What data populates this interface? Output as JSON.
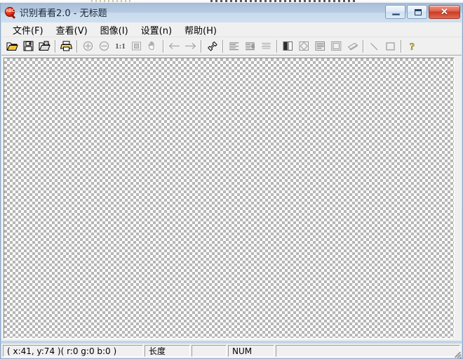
{
  "window": {
    "title": "识别看看2.0 - 无标题",
    "app_icon": "ocr-magnifier-icon",
    "icon_text": "ABC",
    "controls": {
      "minimize_label": "",
      "maximize_label": "",
      "close_label": "✕"
    },
    "accent_title_top": "#9fb7d4",
    "accent_title_bottom": "#cfdff0",
    "close_color": "#c93a24",
    "frame_color": "#c2d4e9"
  },
  "menubar": {
    "items": [
      {
        "label": "文件(F)",
        "name": "menu-file"
      },
      {
        "label": "查看(V)",
        "name": "menu-view"
      },
      {
        "label": "图像(I)",
        "name": "menu-image"
      },
      {
        "label": "设置(n)",
        "name": "menu-settings"
      },
      {
        "label": "帮助(H)",
        "name": "menu-help"
      }
    ]
  },
  "toolbar": {
    "zoom_ratio_label": "1:1",
    "help_label": "?",
    "buttons": [
      {
        "name": "open-file-icon",
        "tooltip": "打开",
        "type": "icon"
      },
      {
        "name": "save-file-icon",
        "tooltip": "保存",
        "type": "icon"
      },
      {
        "name": "save-as-icon",
        "tooltip": "另存为",
        "type": "icon"
      },
      {
        "name": "separator",
        "tooltip": "",
        "type": "sep"
      },
      {
        "name": "print-icon",
        "tooltip": "打印",
        "type": "icon"
      },
      {
        "name": "separator",
        "tooltip": "",
        "type": "sep"
      },
      {
        "name": "zoom-in-icon",
        "tooltip": "放大",
        "type": "icon"
      },
      {
        "name": "zoom-out-icon",
        "tooltip": "缩小",
        "type": "icon"
      },
      {
        "name": "actual-size-icon",
        "tooltip": "1:1",
        "type": "text"
      },
      {
        "name": "fit-to-window-icon",
        "tooltip": "适应窗口",
        "type": "icon"
      },
      {
        "name": "pan-hand-icon",
        "tooltip": "平移",
        "type": "icon"
      },
      {
        "name": "separator",
        "tooltip": "",
        "type": "sep"
      },
      {
        "name": "previous-arrow-icon",
        "tooltip": "上一个",
        "type": "icon"
      },
      {
        "name": "next-arrow-icon",
        "tooltip": "下一个",
        "type": "icon"
      },
      {
        "name": "separator",
        "tooltip": "",
        "type": "sep"
      },
      {
        "name": "measure-length-icon",
        "tooltip": "长度",
        "type": "icon"
      },
      {
        "name": "separator",
        "tooltip": "",
        "type": "sep"
      },
      {
        "name": "align-left-icon",
        "tooltip": "左对齐",
        "type": "icon"
      },
      {
        "name": "align-mixed-icon",
        "tooltip": "对齐",
        "type": "icon"
      },
      {
        "name": "align-justify-icon",
        "tooltip": "两端对齐",
        "type": "icon"
      },
      {
        "name": "separator",
        "tooltip": "",
        "type": "sep"
      },
      {
        "name": "contrast-icon",
        "tooltip": "对比度",
        "type": "icon"
      },
      {
        "name": "rotate-icon",
        "tooltip": "旋转",
        "type": "icon"
      },
      {
        "name": "lines-icon",
        "tooltip": "行",
        "type": "icon"
      },
      {
        "name": "rectangle-select-icon",
        "tooltip": "框选",
        "type": "icon"
      },
      {
        "name": "eraser-icon",
        "tooltip": "橡皮",
        "type": "icon"
      },
      {
        "name": "separator",
        "tooltip": "",
        "type": "sep"
      },
      {
        "name": "line-tool-icon",
        "tooltip": "直线",
        "type": "icon"
      },
      {
        "name": "rect-tool-icon",
        "tooltip": "矩形",
        "type": "icon"
      },
      {
        "name": "separator",
        "tooltip": "",
        "type": "sep"
      },
      {
        "name": "help-icon",
        "tooltip": "帮助",
        "type": "icon"
      }
    ]
  },
  "canvas": {
    "background": "transparent-checkerboard",
    "checker_color": "#b6b6b6",
    "checker_size_px": 8
  },
  "statusbar": {
    "coords": "( x:41, y:74 )( r:0 g:0 b:0 )",
    "length_label": "长度",
    "blank1": "",
    "num_label": "NUM",
    "blank2": ""
  }
}
